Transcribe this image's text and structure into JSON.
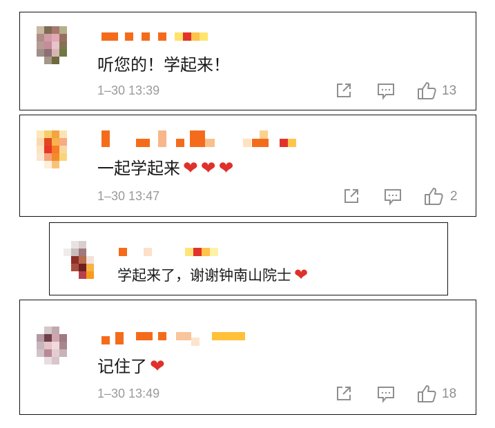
{
  "comments": [
    {
      "text": "听您的！学起来！",
      "hearts": "",
      "time": "1–30 13:39",
      "likes": "13"
    },
    {
      "text": "一起学起来",
      "hearts": "❤❤❤",
      "time": "1–30 13:47",
      "likes": "2"
    },
    {
      "text": "学起来了，谢谢钟南山院士",
      "hearts": "❤"
    },
    {
      "text": "记住了",
      "hearts": "❤",
      "time": "1–30 13:49",
      "likes": "18"
    }
  ],
  "colors": {
    "accent": "#f46c1b",
    "muted": "#9a9a9a",
    "heart": "#e0302b"
  },
  "icons": {
    "share": "share-icon",
    "comment": "comment-icon",
    "like": "thumbs-up-icon"
  }
}
